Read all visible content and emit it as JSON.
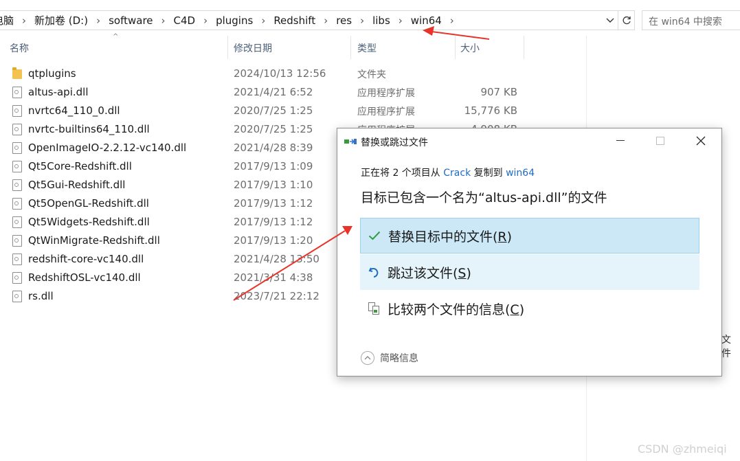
{
  "address_bar": {
    "crumbs": [
      "电脑",
      "新加卷 (D:)",
      "software",
      "C4D",
      "plugins",
      "Redshift",
      "res",
      "libs",
      "win64"
    ]
  },
  "search": {
    "placeholder": "在 win64 中搜索"
  },
  "columns": {
    "name": "名称",
    "date": "修改日期",
    "type": "类型",
    "size": "大小"
  },
  "files": [
    {
      "name": "qtplugins",
      "date": "2024/10/13 12:56",
      "type": "文件夹",
      "size": "",
      "kind": "folder"
    },
    {
      "name": "altus-api.dll",
      "date": "2021/4/21 6:52",
      "type": "应用程序扩展",
      "size": "907 KB",
      "kind": "file"
    },
    {
      "name": "nvrtc64_110_0.dll",
      "date": "2020/7/25 1:25",
      "type": "应用程序扩展",
      "size": "15,776 KB",
      "kind": "file"
    },
    {
      "name": "nvrtc-builtins64_110.dll",
      "date": "2020/7/25 1:25",
      "type": "",
      "size": "",
      "kind": "file"
    },
    {
      "name": "OpenImageIO-2.2.12-vc140.dll",
      "date": "2021/4/28 8:39",
      "type": "",
      "size": "",
      "kind": "file"
    },
    {
      "name": "Qt5Core-Redshift.dll",
      "date": "2017/9/13 1:09",
      "type": "",
      "size": "",
      "kind": "file"
    },
    {
      "name": "Qt5Gui-Redshift.dll",
      "date": "2017/9/13 1:10",
      "type": "",
      "size": "",
      "kind": "file"
    },
    {
      "name": "Qt5OpenGL-Redshift.dll",
      "date": "2017/9/13 1:12",
      "type": "",
      "size": "",
      "kind": "file"
    },
    {
      "name": "Qt5Widgets-Redshift.dll",
      "date": "2017/9/13 1:12",
      "type": "",
      "size": "",
      "kind": "file"
    },
    {
      "name": "QtWinMigrate-Redshift.dll",
      "date": "2017/9/13 1:20",
      "type": "",
      "size": "",
      "kind": "file"
    },
    {
      "name": "redshift-core-vc140.dll",
      "date": "2021/4/28 13:50",
      "type": "",
      "size": "",
      "kind": "file"
    },
    {
      "name": "RedshiftOSL-vc140.dll",
      "date": "2021/3/31 4:38",
      "type": "",
      "size": "",
      "kind": "file"
    },
    {
      "name": "rs.dll",
      "date": "2023/7/21 22:12",
      "type": "",
      "size": "",
      "kind": "file"
    }
  ],
  "partial_row_text": {
    "type": "应用程序扩展",
    "size": "4,908 KB"
  },
  "dialog": {
    "title": "替换或跳过文件",
    "line1_prefix": "正在将 2 个项目从 ",
    "line1_source": "Crack",
    "line1_mid": " 复制到 ",
    "line1_dest": "win64",
    "line2": "目标已包含一个名为“altus-api.dll”的文件",
    "options": [
      {
        "label": "替换目标中的文件(",
        "key": "R",
        "end": ")"
      },
      {
        "label": "跳过该文件(",
        "key": "S",
        "end": ")"
      },
      {
        "label": "比较两个文件的信息(",
        "key": "C",
        "end": ")"
      }
    ],
    "details": "简略信息"
  },
  "stray_text": "文件",
  "watermark": "CSDN @zhmeiqi",
  "colors": {
    "selected_option": "#cce8f7",
    "hover_option": "#e5f3fb",
    "link": "#1f6cc1",
    "arrow": "#e8332a"
  },
  "icons": [
    "folder-icon",
    "dll-file-icon",
    "check-icon",
    "skip-icon",
    "compare-icon",
    "close-icon",
    "minimize-icon",
    "maximize-icon",
    "refresh-icon",
    "chevron-right-icon",
    "chevron-down-icon",
    "details-toggle-icon"
  ]
}
